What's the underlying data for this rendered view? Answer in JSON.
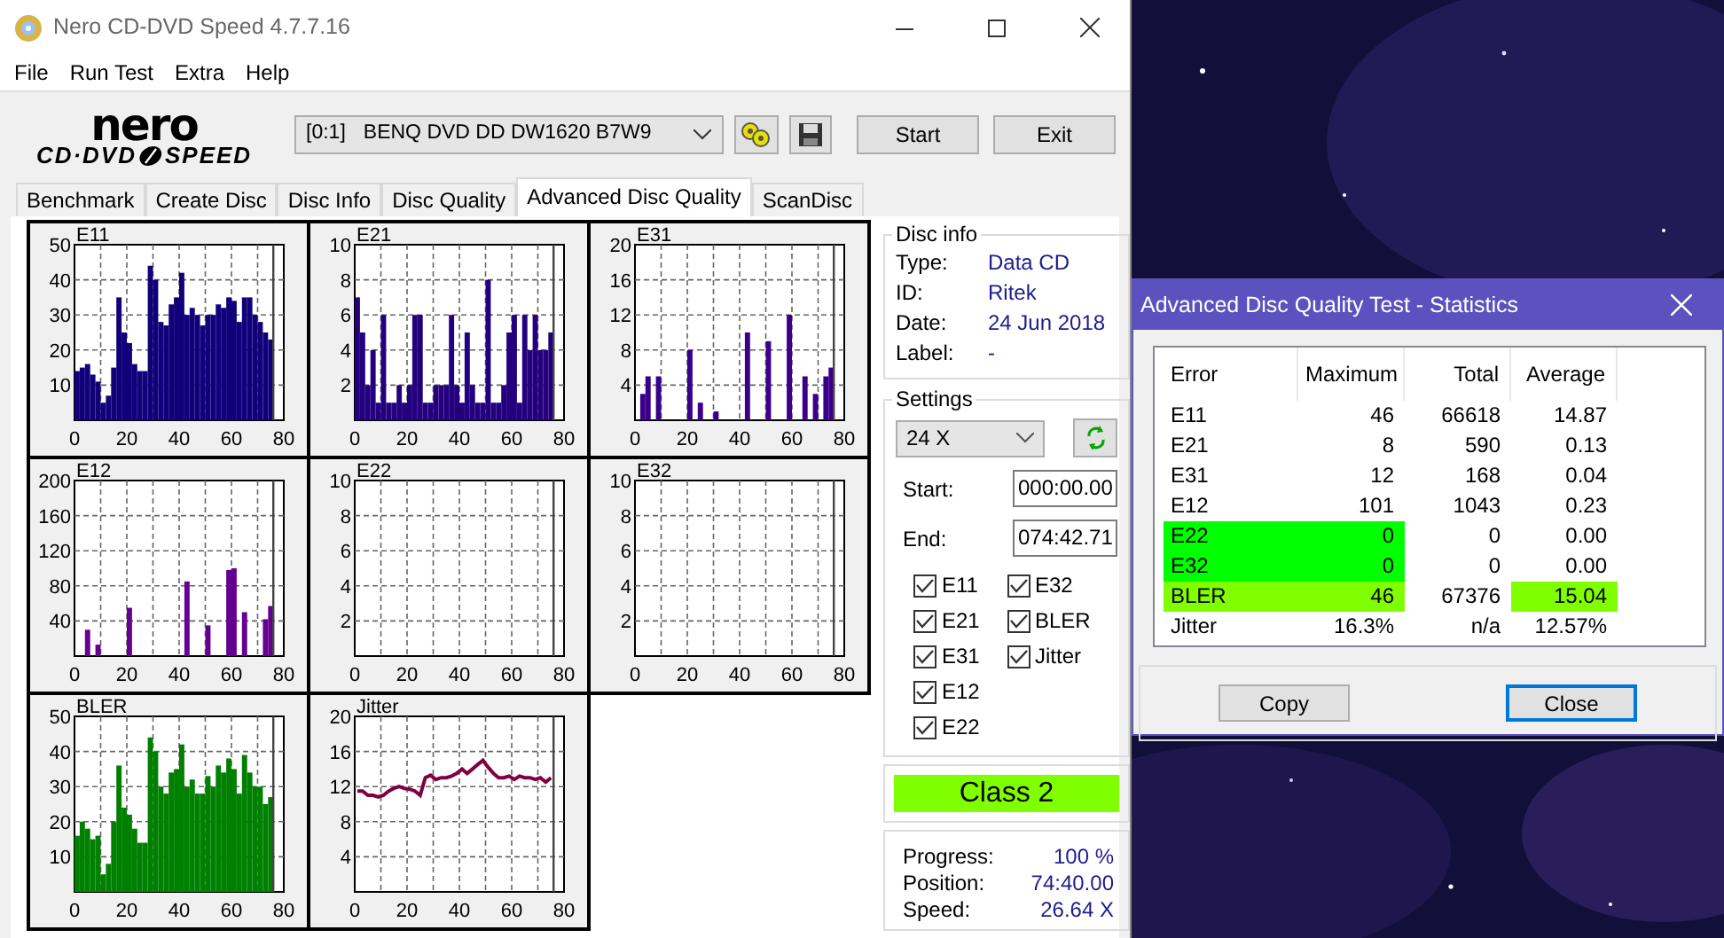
{
  "window": {
    "title": "Nero CD-DVD Speed 4.7.7.16"
  },
  "menu": [
    "File",
    "Run Test",
    "Extra",
    "Help"
  ],
  "logo": {
    "top": "nero",
    "left": "CD·DVD",
    "right": "SPEED"
  },
  "toolbar": {
    "drive_id": "[0:1]",
    "drive_name": "BENQ DVD DD DW1620 B7W9",
    "buttons": [
      "Start",
      "Exit"
    ]
  },
  "tabs": [
    {
      "label": "Benchmark",
      "selected": false
    },
    {
      "label": "Create Disc",
      "selected": false
    },
    {
      "label": "Disc Info",
      "selected": false
    },
    {
      "label": "Disc Quality",
      "selected": false
    },
    {
      "label": "Advanced Disc Quality",
      "selected": true
    },
    {
      "label": "ScanDisc",
      "selected": false
    }
  ],
  "charts": [
    {
      "chart_data": {
        "type": "bar",
        "grid": true,
        "ref_lines": [
          {
            "axis": "x",
            "value": 76
          }
        ],
        "x": [
          0,
          2,
          4,
          6,
          8,
          10,
          12,
          14,
          16,
          18,
          20,
          22,
          24,
          26,
          28,
          30,
          32,
          34,
          36,
          38,
          40,
          42,
          44,
          46,
          48,
          50,
          52,
          54,
          56,
          58,
          60,
          62,
          64,
          66,
          68,
          70,
          72,
          74
        ],
        "series": [
          {
            "name": "E11",
            "color": "#12007a",
            "values": [
              14,
              15,
              16,
              13,
              11,
              5,
              7,
              15,
              35,
              25,
              22,
              16,
              14,
              14,
              44,
              40,
              28,
              27,
              33,
              35,
              42,
              30,
              32,
              30,
              27,
              30,
              30,
              33,
              32,
              35,
              34,
              28,
              35,
              35,
              30,
              28,
              25,
              23
            ]
          }
        ],
        "xlim": [
          0,
          80
        ],
        "ylim": [
          0,
          50
        ],
        "xticks": [
          0,
          20,
          40,
          60,
          80
        ],
        "yticks": [
          10,
          20,
          30,
          40,
          50
        ]
      }
    },
    {
      "chart_data": {
        "type": "bar",
        "grid": true,
        "ref_lines": [
          {
            "axis": "x",
            "value": 76
          }
        ],
        "x": [
          0,
          2,
          4,
          6,
          8,
          10,
          12,
          14,
          16,
          18,
          20,
          22,
          24,
          26,
          28,
          30,
          32,
          34,
          36,
          38,
          40,
          42,
          44,
          46,
          48,
          50,
          52,
          54,
          56,
          58,
          60,
          62,
          64,
          66,
          68,
          70,
          72,
          74
        ],
        "series": [
          {
            "name": "E21",
            "color": "#24007e",
            "values": [
              7,
              5,
              2,
              4,
              1,
              6,
              1,
              1,
              2,
              1,
              2,
              6,
              6,
              1,
              1,
              2,
              2,
              2,
              6,
              2,
              1,
              5,
              2,
              1,
              1,
              8,
              1,
              1,
              2,
              5,
              6,
              1,
              6,
              4,
              6,
              4,
              4,
              5
            ]
          }
        ],
        "xlim": [
          0,
          80
        ],
        "ylim": [
          0,
          10
        ],
        "xticks": [
          0,
          20,
          40,
          60,
          80
        ],
        "yticks": [
          2,
          4,
          6,
          8,
          10
        ]
      }
    },
    {
      "chart_data": {
        "type": "bar",
        "grid": true,
        "ref_lines": [
          {
            "axis": "x",
            "value": 76
          }
        ],
        "x": [
          0,
          2,
          4,
          6,
          8,
          10,
          12,
          14,
          16,
          18,
          20,
          22,
          24,
          26,
          28,
          30,
          32,
          34,
          36,
          38,
          40,
          42,
          44,
          46,
          48,
          50,
          52,
          54,
          56,
          58,
          60,
          62,
          64,
          66,
          68,
          70,
          72,
          74
        ],
        "series": [
          {
            "name": "E31",
            "color": "#3a008c",
            "values": [
              0,
              3,
              5,
              0,
              5,
              0,
              0,
              0,
              0,
              0,
              8,
              0,
              2,
              0,
              0,
              1,
              0,
              0,
              0,
              0,
              0,
              10,
              0,
              0,
              0,
              9,
              0,
              0,
              0,
              12,
              0,
              0,
              5,
              0,
              3,
              0,
              5,
              6
            ]
          }
        ],
        "xlim": [
          0,
          80
        ],
        "ylim": [
          0,
          20
        ],
        "xticks": [
          0,
          20,
          40,
          60,
          80
        ],
        "yticks": [
          4,
          8,
          12,
          16,
          20
        ]
      }
    },
    {
      "chart_data": {
        "type": "bar",
        "grid": true,
        "ref_lines": [
          {
            "axis": "x",
            "value": 76
          }
        ],
        "x": [
          0,
          2,
          4,
          6,
          8,
          10,
          12,
          14,
          16,
          18,
          20,
          22,
          24,
          26,
          28,
          30,
          32,
          34,
          36,
          38,
          40,
          42,
          44,
          46,
          48,
          50,
          52,
          54,
          56,
          58,
          60,
          62,
          64,
          66,
          68,
          70,
          72,
          74
        ],
        "series": [
          {
            "name": "E12",
            "color": "#660090",
            "values": [
              0,
              0,
              30,
              0,
              13,
              0,
              0,
              0,
              0,
              0,
              55,
              0,
              0,
              0,
              0,
              0,
              0,
              0,
              0,
              0,
              0,
              85,
              0,
              0,
              0,
              35,
              0,
              0,
              0,
              98,
              100,
              0,
              50,
              0,
              0,
              0,
              42,
              57
            ]
          }
        ],
        "xlim": [
          0,
          80
        ],
        "ylim": [
          0,
          200
        ],
        "xticks": [
          0,
          20,
          40,
          60,
          80
        ],
        "yticks": [
          40,
          80,
          120,
          160,
          200
        ]
      }
    },
    {
      "chart_data": {
        "type": "bar",
        "grid": true,
        "ref_lines": [
          {
            "axis": "x",
            "value": 76
          }
        ],
        "x": [
          0,
          2,
          4,
          6,
          8,
          10,
          12,
          14,
          16,
          18,
          20,
          22,
          24,
          26,
          28,
          30,
          32,
          34,
          36,
          38,
          40,
          42,
          44,
          46,
          48,
          50,
          52,
          54,
          56,
          58,
          60,
          62,
          64,
          66,
          68,
          70,
          72,
          74
        ],
        "series": [
          {
            "name": "E22",
            "values": [
              0,
              0,
              0,
              0,
              0,
              0,
              0,
              0,
              0,
              0,
              0,
              0,
              0,
              0,
              0,
              0,
              0,
              0,
              0,
              0,
              0,
              0,
              0,
              0,
              0,
              0,
              0,
              0,
              0,
              0,
              0,
              0,
              0,
              0,
              0,
              0,
              0,
              0
            ]
          }
        ],
        "xlim": [
          0,
          80
        ],
        "ylim": [
          0,
          10
        ],
        "xticks": [
          0,
          20,
          40,
          60,
          80
        ],
        "yticks": [
          2,
          4,
          6,
          8,
          10
        ]
      }
    },
    {
      "chart_data": {
        "type": "bar",
        "grid": true,
        "ref_lines": [
          {
            "axis": "x",
            "value": 76
          }
        ],
        "x": [
          0,
          2,
          4,
          6,
          8,
          10,
          12,
          14,
          16,
          18,
          20,
          22,
          24,
          26,
          28,
          30,
          32,
          34,
          36,
          38,
          40,
          42,
          44,
          46,
          48,
          50,
          52,
          54,
          56,
          58,
          60,
          62,
          64,
          66,
          68,
          70,
          72,
          74
        ],
        "series": [
          {
            "name": "E32",
            "values": [
              0,
              0,
              0,
              0,
              0,
              0,
              0,
              0,
              0,
              0,
              0,
              0,
              0,
              0,
              0,
              0,
              0,
              0,
              0,
              0,
              0,
              0,
              0,
              0,
              0,
              0,
              0,
              0,
              0,
              0,
              0,
              0,
              0,
              0,
              0,
              0,
              0,
              0
            ]
          }
        ],
        "xlim": [
          0,
          80
        ],
        "ylim": [
          0,
          10
        ],
        "xticks": [
          0,
          20,
          40,
          60,
          80
        ],
        "yticks": [
          2,
          4,
          6,
          8,
          10
        ]
      }
    },
    {
      "chart_data": {
        "type": "bar",
        "grid": true,
        "ref_lines": [
          {
            "axis": "x",
            "value": 76
          }
        ],
        "x": [
          0,
          2,
          4,
          6,
          8,
          10,
          12,
          14,
          16,
          18,
          20,
          22,
          24,
          26,
          28,
          30,
          32,
          34,
          36,
          38,
          40,
          42,
          44,
          46,
          48,
          50,
          52,
          54,
          56,
          58,
          60,
          62,
          64,
          66,
          68,
          70,
          72,
          74
        ],
        "series": [
          {
            "name": "BLER",
            "color": "#008000",
            "values": [
              16,
              20,
              18,
              15,
              16,
              5,
              8,
              20,
              36,
              24,
              22,
              18,
              14,
              14,
              44,
              40,
              30,
              28,
              34,
              35,
              42,
              30,
              32,
              28,
              28,
              33,
              30,
              36,
              34,
              38,
              35,
              28,
              39,
              34,
              30,
              30,
              25,
              27
            ]
          }
        ],
        "xlim": [
          0,
          80
        ],
        "ylim": [
          0,
          50
        ],
        "xticks": [
          0,
          20,
          40,
          60,
          80
        ],
        "yticks": [
          10,
          20,
          30,
          40,
          50
        ]
      }
    },
    {
      "chart_data": {
        "type": "line",
        "grid": true,
        "ref_lines": [
          {
            "axis": "x",
            "value": 76
          }
        ],
        "x": [
          0,
          2,
          4,
          6,
          8,
          10,
          12,
          14,
          16,
          18,
          20,
          22,
          24,
          26,
          28,
          30,
          32,
          34,
          36,
          38,
          40,
          42,
          44,
          46,
          48,
          50,
          52,
          54,
          56,
          58,
          60,
          62,
          64,
          66,
          68,
          70,
          72,
          74
        ],
        "series": [
          {
            "name": "Jitter",
            "color": "#800040",
            "values": [
              11.5,
              11.5,
              11,
              11,
              10.8,
              11,
              11.5,
              11.8,
              12,
              11.8,
              11.7,
              11.5,
              11,
              13,
              13.3,
              12.8,
              13,
              13,
              13.2,
              13.5,
              14,
              13.5,
              14,
              14.5,
              15,
              14.2,
              13.5,
              13,
              13,
              13.2,
              12.8,
              13.2,
              13,
              13,
              12.8,
              13,
              12.5,
              13
            ]
          }
        ],
        "xlim": [
          0,
          80
        ],
        "ylim": [
          0,
          20
        ],
        "xticks": [
          0,
          20,
          40,
          60,
          80
        ],
        "yticks": [
          4,
          8,
          12,
          16,
          20
        ]
      }
    }
  ],
  "disc_info": {
    "title": "Disc info",
    "fields": [
      {
        "label": "Type:",
        "value": "Data CD"
      },
      {
        "label": "ID:",
        "value": "Ritek"
      },
      {
        "label": "Date:",
        "value": "24 Jun 2018"
      },
      {
        "label": "Label:",
        "value": "-"
      }
    ]
  },
  "settings": {
    "title": "Settings",
    "speed": "24 X",
    "start_label": "Start:",
    "start": "000:00.00",
    "end_label": "End:",
    "end": "074:42.71",
    "checks": [
      {
        "label": "E11",
        "checked": true
      },
      {
        "label": "E21",
        "checked": true
      },
      {
        "label": "E31",
        "checked": true
      },
      {
        "label": "E12",
        "checked": true
      },
      {
        "label": "E22",
        "checked": true
      },
      {
        "label": "E32",
        "checked": true
      },
      {
        "label": "BLER",
        "checked": true
      },
      {
        "label": "Jitter",
        "checked": true
      }
    ]
  },
  "class_badge": "Class 2",
  "progress": [
    {
      "label": "Progress:",
      "value": "100 %"
    },
    {
      "label": "Position:",
      "value": "74:40.00"
    },
    {
      "label": "Speed:",
      "value": "26.64 X"
    }
  ],
  "stats": {
    "title": "Advanced Disc Quality Test - Statistics",
    "columns": [
      "Error",
      "Maximum",
      "Total",
      "Average"
    ],
    "rows": [
      {
        "cells": [
          {
            "text": "E11"
          },
          {
            "text": "46"
          },
          {
            "text": "66618"
          },
          {
            "text": "14.87"
          }
        ]
      },
      {
        "cells": [
          {
            "text": "E21"
          },
          {
            "text": "8"
          },
          {
            "text": "590"
          },
          {
            "text": "0.13"
          }
        ]
      },
      {
        "cells": [
          {
            "text": "E31"
          },
          {
            "text": "12"
          },
          {
            "text": "168"
          },
          {
            "text": "0.04"
          }
        ]
      },
      {
        "cells": [
          {
            "text": "E12"
          },
          {
            "text": "101"
          },
          {
            "text": "1043"
          },
          {
            "text": "0.23"
          }
        ]
      },
      {
        "cells": [
          {
            "text": "E22",
            "color": "#00ff00"
          },
          {
            "text": "0",
            "color": "#00ff00"
          },
          {
            "text": "0"
          },
          {
            "text": "0.00"
          }
        ]
      },
      {
        "cells": [
          {
            "text": "E32",
            "color": "#00ff00"
          },
          {
            "text": "0",
            "color": "#00ff00"
          },
          {
            "text": "0"
          },
          {
            "text": "0.00"
          }
        ]
      },
      {
        "cells": [
          {
            "text": "BLER",
            "color": "#80ff00"
          },
          {
            "text": "46",
            "color": "#80ff00"
          },
          {
            "text": "67376"
          },
          {
            "text": "15.04",
            "color": "#80ff00"
          }
        ]
      },
      {
        "cells": [
          {
            "text": "Jitter"
          },
          {
            "text": "16.3%"
          },
          {
            "text": "n/a"
          },
          {
            "text": "12.57%"
          }
        ]
      }
    ],
    "buttons": [
      {
        "label": "Copy",
        "default": false
      },
      {
        "label": "Close",
        "default": true
      }
    ]
  }
}
